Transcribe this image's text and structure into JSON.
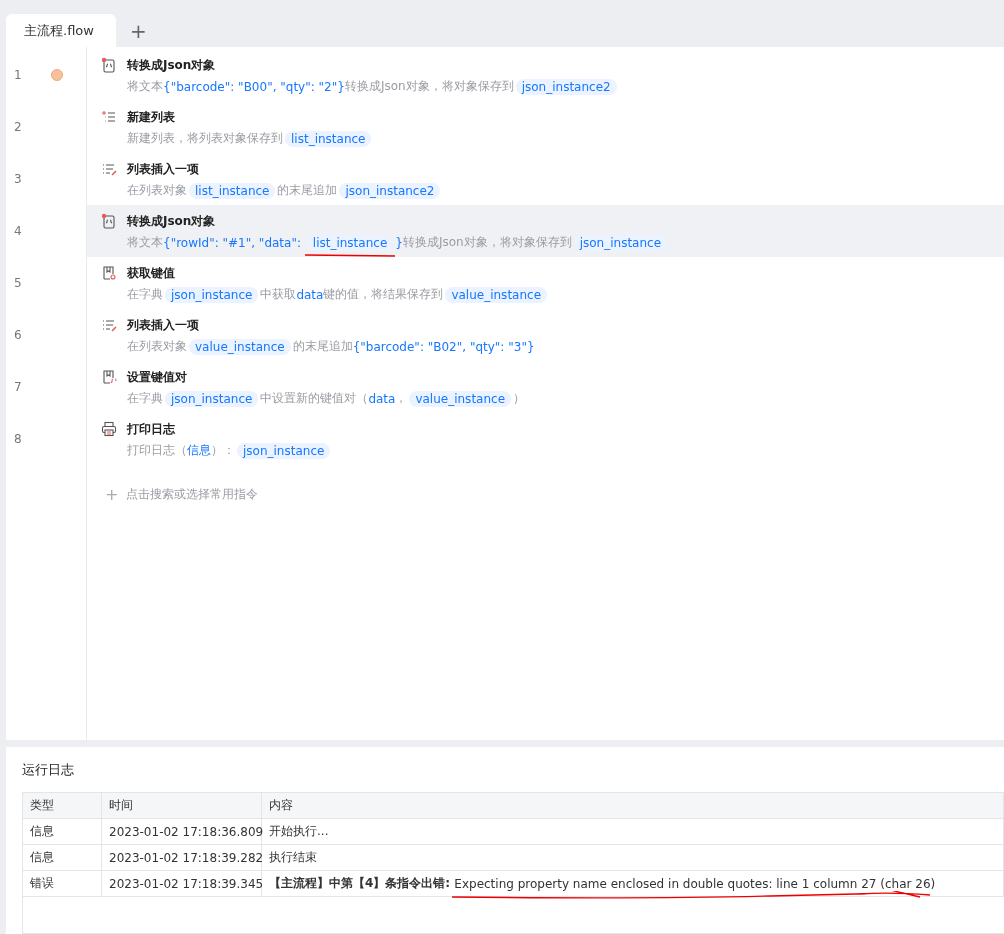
{
  "tabs": [
    {
      "label": "主流程.flow",
      "selected": true
    }
  ],
  "add_tab": "+",
  "steps": [
    {
      "number": "1",
      "breakpoint": true,
      "selected": false,
      "kind": "json",
      "title": "转换成Json对象",
      "description": [
        {
          "kind": "text",
          "text": "将文本"
        },
        {
          "kind": "code",
          "text": "{\"barcode\": \"B00\", \"qty\": \"2\"}"
        },
        {
          "kind": "text",
          "text": "转换成Json对象，将对象保存到"
        },
        {
          "kind": "var",
          "text": "json_instance2"
        }
      ]
    },
    {
      "number": "2",
      "breakpoint": false,
      "selected": false,
      "kind": "new-list",
      "title": "新建列表",
      "description": [
        {
          "kind": "text",
          "text": "新建列表，将列表对象保存到"
        },
        {
          "kind": "var",
          "text": "list_instance"
        }
      ]
    },
    {
      "number": "3",
      "breakpoint": false,
      "selected": false,
      "kind": "list-insert",
      "title": "列表插入一项",
      "description": [
        {
          "kind": "text",
          "text": "在列表对象"
        },
        {
          "kind": "var",
          "text": "list_instance"
        },
        {
          "kind": "text",
          "text": "的末尾追加"
        },
        {
          "kind": "var",
          "text": "json_instance2"
        }
      ]
    },
    {
      "number": "4",
      "breakpoint": false,
      "selected": true,
      "kind": "json",
      "title": "转换成Json对象",
      "description": [
        {
          "kind": "text",
          "text": "将文本"
        },
        {
          "kind": "code",
          "text": "{\"rowId\": \"#1\", \"data\": "
        },
        {
          "kind": "var",
          "text": "list_instance",
          "underlined": true
        },
        {
          "kind": "code",
          "text": "}"
        },
        {
          "kind": "text",
          "text": "转换成Json对象，将对象保存到"
        },
        {
          "kind": "var",
          "text": "json_instance"
        }
      ]
    },
    {
      "number": "5",
      "breakpoint": false,
      "selected": false,
      "kind": "dict-get",
      "title": "获取键值",
      "description": [
        {
          "kind": "text",
          "text": "在字典"
        },
        {
          "kind": "var",
          "text": "json_instance"
        },
        {
          "kind": "text",
          "text": "中获取"
        },
        {
          "kind": "code",
          "text": "data"
        },
        {
          "kind": "text",
          "text": "键的值，将结果保存到"
        },
        {
          "kind": "var",
          "text": "value_instance"
        }
      ]
    },
    {
      "number": "6",
      "breakpoint": false,
      "selected": false,
      "kind": "list-insert",
      "title": "列表插入一项",
      "description": [
        {
          "kind": "text",
          "text": "在列表对象"
        },
        {
          "kind": "var",
          "text": "value_instance"
        },
        {
          "kind": "text",
          "text": "的末尾追加"
        },
        {
          "kind": "code",
          "text": "{\"barcode\": \"B02\", \"qty\": \"3\"}"
        }
      ]
    },
    {
      "number": "7",
      "breakpoint": false,
      "selected": false,
      "kind": "dict-set",
      "title": "设置键值对",
      "description": [
        {
          "kind": "text",
          "text": "在字典"
        },
        {
          "kind": "var",
          "text": "json_instance"
        },
        {
          "kind": "text",
          "text": "中设置新的键值对（"
        },
        {
          "kind": "code",
          "text": "data"
        },
        {
          "kind": "text",
          "text": "，"
        },
        {
          "kind": "var",
          "text": "value_instance"
        },
        {
          "kind": "text",
          "text": "）"
        }
      ]
    },
    {
      "number": "8",
      "breakpoint": false,
      "selected": false,
      "kind": "print",
      "title": "打印日志",
      "description": [
        {
          "kind": "text",
          "text": "打印日志（"
        },
        {
          "kind": "code",
          "text": "信息"
        },
        {
          "kind": "text",
          "text": "）："
        },
        {
          "kind": "var",
          "text": "json_instance"
        }
      ]
    }
  ],
  "add_command": {
    "icon": "+",
    "label": "点击搜索或选择常用指令"
  },
  "log": {
    "title": "运行日志",
    "columns": [
      "类型",
      "时间",
      "内容"
    ],
    "rows": [
      {
        "type": "信息",
        "time": "2023-01-02 17:18:36.809",
        "message": [
          {
            "text": "开始执行...",
            "strong": false,
            "underlined": false
          }
        ]
      },
      {
        "type": "信息",
        "time": "2023-01-02 17:18:39.282",
        "message": [
          {
            "text": "执行结束",
            "strong": false,
            "underlined": false
          }
        ]
      },
      {
        "type": "错误",
        "time": "2023-01-02 17:18:39.345",
        "message": [
          {
            "text": "【主流程】中第【4】条指令出错: ",
            "strong": true,
            "underlined": false
          },
          {
            "text": "Expecting property name enclosed in double quotes: line 1 column 27 (char 26)",
            "strong": false,
            "underlined": true
          }
        ]
      }
    ]
  }
}
